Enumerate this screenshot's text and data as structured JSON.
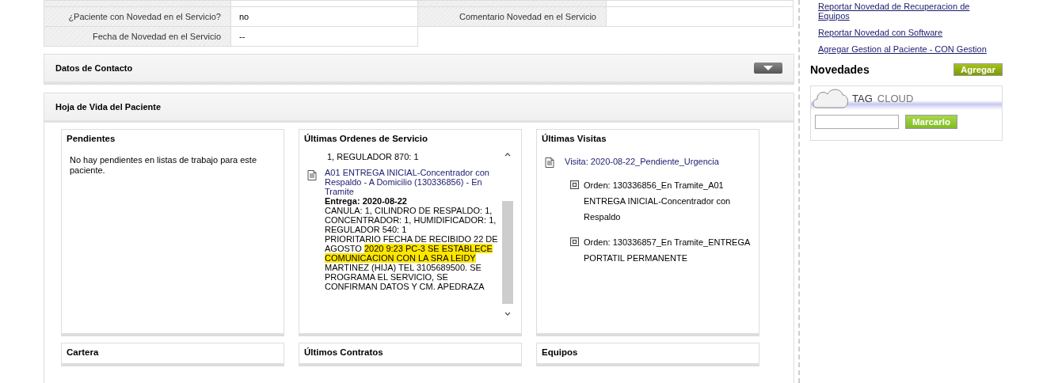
{
  "patient_table": {
    "rows": [
      {
        "label": "¿Paciente con Novedad en el Servicio?",
        "value": "no",
        "label_2": "Comentario Novedad en el Servicio"
      },
      {
        "label": "Fecha de Novedad en el Servicio",
        "value": "--"
      }
    ]
  },
  "contact_panel": {
    "title": "Datos de Contacto",
    "expanded": false
  },
  "history_panel": {
    "title": "Hoja de Vida del Paciente",
    "pendientes": {
      "title": "Pendientes",
      "message": "No hay pendientes en listas de trabajo para este paciente."
    },
    "ordenes": {
      "title": "Últimas Ordenes de Servicio",
      "cut_text": "1, REGULADOR 870: 1",
      "items": [
        {
          "link": "A01 ENTREGA INICIAL-Concentrador con Respaldo - A Domicilio (130336856) - En Tramite",
          "delivery": "Entrega: 2020-08-22",
          "details": "CANULA: 1, CILINDRO DE RESPALDO: 1, CONCENTRADOR: 1, HUMIDIFICADOR: 1, REGULADOR 540: 1",
          "note": "PRIORITARIO FECHA DE RECIBIDO 22 DE AGOSTO",
          "note_highlighted": "2020 9:23 PC-3 SE ESTABLECE COMUNICACION CON LA SRA LEIDY",
          "note_rest": "MARTINEZ (HIJA) TEL 3105689500. SE PROGRAMA EL SERVICIO, SE CONFIRMAN DATOS Y CM. APEDRAZA"
        }
      ]
    },
    "visitas": {
      "title": "Últimas Visitas",
      "items": [
        {
          "link": "Visita: 2020-08-22_Pendiente_Urgencia",
          "orders": [
            "Orden: 130336856_En Tramite_A01 ENTREGA INICIAL-Concentrador con Respaldo",
            "Orden: 130336857_En Tramite_ENTREGA PORTATIL PERMANENTE"
          ]
        }
      ]
    },
    "bottom_cards": [
      "Cartera",
      "Últimos Contratos",
      "Equipos"
    ]
  },
  "sidebar": {
    "links": [
      "Reportar Novedad de Recuperacion de Equipos",
      "Reportar Novedad con Software",
      "Agregar Gestion al Paciente - CON Gestion"
    ],
    "novedades": {
      "title": "Novedades",
      "button": "Agregar"
    },
    "tag_cloud": {
      "title_1": "TAG",
      "title_2": "CLOUD",
      "button": "Marcarlo"
    }
  }
}
